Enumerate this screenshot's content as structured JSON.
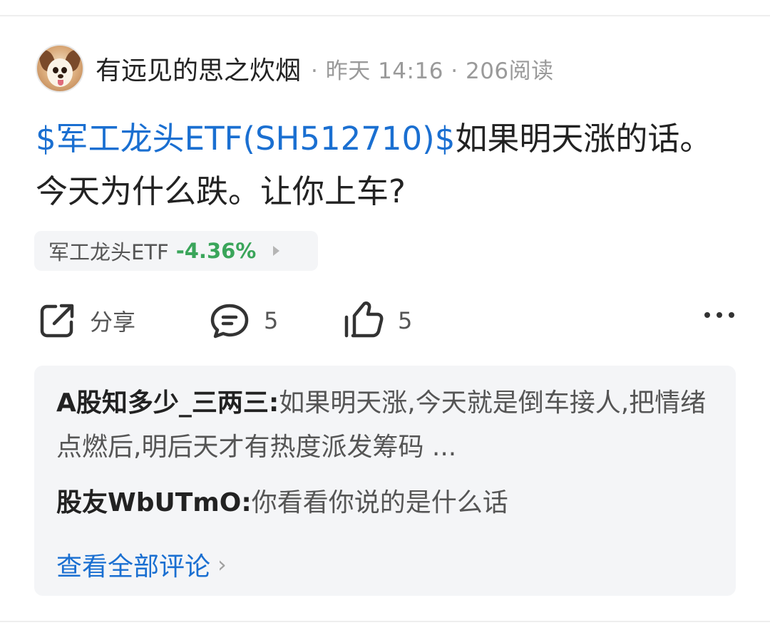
{
  "post": {
    "username": "有远见的思之炊烟",
    "meta": "· 昨天 14:16 · 206阅读",
    "stock_link_text": "$军工龙头ETF(SH512710)$",
    "body_text": "如果明天涨的话。今天为什么跌。让你上车?"
  },
  "stock_chip": {
    "name": "军工龙头ETF",
    "change": "-4.36%",
    "change_color": "#3aa55a"
  },
  "actions": {
    "share_label": "分享",
    "comment_count": "5",
    "like_count": "5",
    "icons": [
      "share-icon",
      "comment-icon",
      "like-icon",
      "more-icon"
    ]
  },
  "comments": {
    "items": [
      {
        "author": "A股知多少_三两三",
        "separator": ":",
        "text": "如果明天涨,今天就是倒车接人,把情绪点燃后,明后天才有热度派发筹码 ..."
      },
      {
        "author": "股友WbUTmO",
        "separator": ":",
        "text": "你看看你说的是什么话"
      }
    ],
    "view_all_label": "查看全部评论"
  },
  "colors": {
    "link": "#1a6fd1",
    "text": "#222222",
    "muted": "#9a9a9a",
    "panel": "#f4f5f7"
  }
}
